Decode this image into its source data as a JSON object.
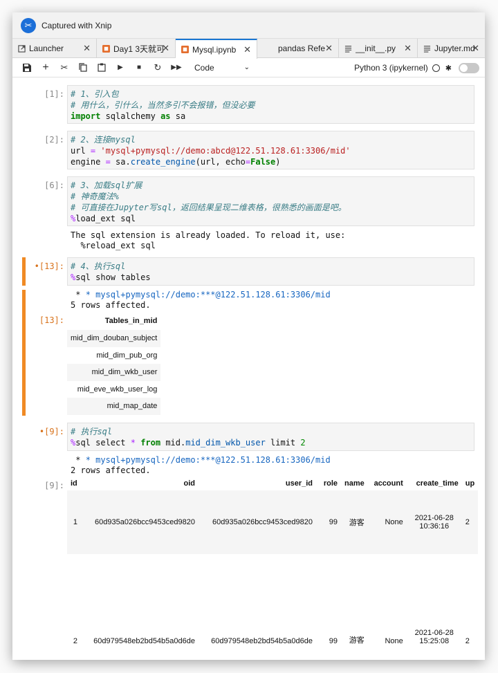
{
  "window": {
    "title": "Captured with Xnip"
  },
  "tabs": [
    {
      "label": "Launcher",
      "icon": "launcher-icon"
    },
    {
      "label": "Day1 3天就可",
      "icon": "notebook-icon"
    },
    {
      "label": "Mysql.ipynb",
      "icon": "notebook-icon",
      "active": true
    },
    {
      "label": "pandas Refe",
      "icon": ""
    },
    {
      "label": "__init__.py",
      "icon": "file-icon"
    },
    {
      "label": "Jupyter.md",
      "icon": "file-icon"
    }
  ],
  "toolbar": {
    "cell_type": "Code",
    "kernel_name": "Python 3 (ipykernel)"
  },
  "cells": {
    "c1": {
      "prompt": "[1]:",
      "lines": [
        "# 1、引入包",
        "# 用什么，引什么，当然多引不会报错，但没必要",
        "import sqlalchemy as sa"
      ]
    },
    "c2": {
      "prompt": "[2]:",
      "lines": [
        "# 2、连接mysql",
        "url = 'mysql+pymysql://demo:abcd@122.51.128.61:3306/mid'",
        "engine = sa.create_engine(url, echo=False)"
      ]
    },
    "c3": {
      "prompt": "[6]:",
      "lines": [
        "# 3、加载sql扩展",
        "# 神奇魔法%",
        "# 可直接在Jupyter写sql，返回结果呈现二维表格，很熟悉的画面是吧。",
        "%load_ext sql"
      ],
      "output": [
        "The sql extension is already loaded. To reload it, use:",
        "  %reload_ext sql"
      ]
    },
    "c4": {
      "prompt": "•[13]:",
      "lines": [
        "# 4、执行sql",
        "%sql show tables"
      ],
      "output_lines": [
        "* mysql+pymysql://demo:***@122.51.128.61:3306/mid",
        "5 rows affected."
      ],
      "out_prompt": "[13]:",
      "table_header": "Tables_in_mid",
      "table_rows": [
        "mid_dim_douban_subject",
        "mid_dim_pub_org",
        "mid_dim_wkb_user",
        "mid_eve_wkb_user_log",
        "mid_map_date"
      ]
    },
    "c5": {
      "prompt": "•[9]:",
      "lines": [
        "# 执行sql",
        "%sql select * from mid.mid_dim_wkb_user limit 2"
      ],
      "output_lines": [
        "* mysql+pymysql://demo:***@122.51.128.61:3306/mid",
        "2 rows affected."
      ],
      "out_prompt": "[9]:",
      "columns": [
        "id",
        "oid",
        "user_id",
        "role",
        "name",
        "account",
        "create_time",
        "up"
      ],
      "rows": [
        [
          "1",
          "60d935a026bcc9453ced9820",
          "60d935a026bcc9453ced9820",
          "99",
          "游客",
          "None",
          "2021-06-28",
          "10:36:16",
          "2"
        ],
        [
          "2",
          "60d979548eb2bd54b5a0d6de",
          "60d979548eb2bd54b5a0d6de",
          "99",
          "游客",
          "None",
          "2021-06-28",
          "15:25:08",
          "2"
        ]
      ]
    }
  }
}
